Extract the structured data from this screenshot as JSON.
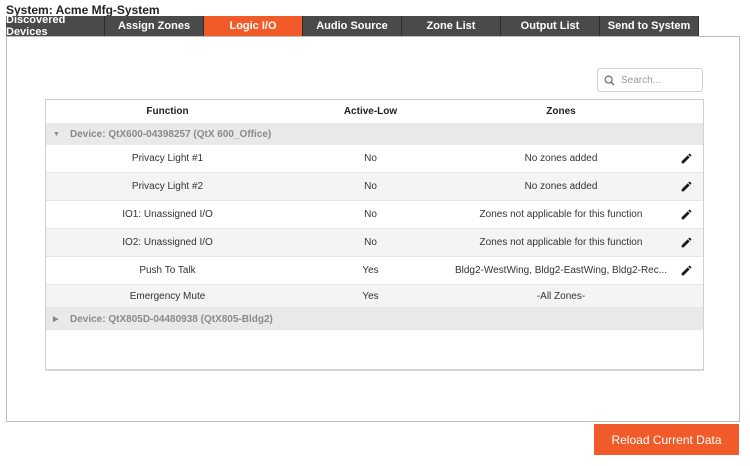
{
  "system_title": "System: Acme Mfg-System",
  "tabs": [
    {
      "label": "Discovered Devices",
      "active": false
    },
    {
      "label": "Assign Zones",
      "active": false
    },
    {
      "label": "Logic I/O",
      "active": true
    },
    {
      "label": "Audio Source",
      "active": false
    },
    {
      "label": "Zone List",
      "active": false
    },
    {
      "label": "Output List",
      "active": false
    },
    {
      "label": "Send to System",
      "active": false
    }
  ],
  "search": {
    "placeholder": "Search..."
  },
  "table": {
    "headers": {
      "function": "Function",
      "active_low": "Active-Low",
      "zones": "Zones"
    },
    "groups": [
      {
        "label": "Device: QtX600-04398257 (QtX 600_Office)",
        "expanded": true
      },
      {
        "label": "Device: QtX805D-04480938 (QtX805-Bldg2)",
        "expanded": false
      }
    ],
    "rows": [
      {
        "function": "Privacy Light #1",
        "active_low": "No",
        "zones": "No zones added",
        "editable": true
      },
      {
        "function": "Privacy Light #2",
        "active_low": "No",
        "zones": "No zones added",
        "editable": true
      },
      {
        "function": "IO1: Unassigned I/O",
        "active_low": "No",
        "zones": "Zones not applicable for this function",
        "editable": true
      },
      {
        "function": "IO2: Unassigned I/O",
        "active_low": "No",
        "zones": "Zones not applicable for this function",
        "editable": true
      },
      {
        "function": "Push To Talk",
        "active_low": "Yes",
        "zones": "Bldg2-WestWing, Bldg2-EastWing, Bldg2-Rec...",
        "editable": true
      },
      {
        "function": "Emergency Mute",
        "active_low": "Yes",
        "zones": "-All Zones-",
        "editable": false
      }
    ]
  },
  "reload_button": {
    "label": "Reload Current Data"
  },
  "colors": {
    "accent": "#f15a29",
    "tab_bg": "#4a4a4a"
  }
}
